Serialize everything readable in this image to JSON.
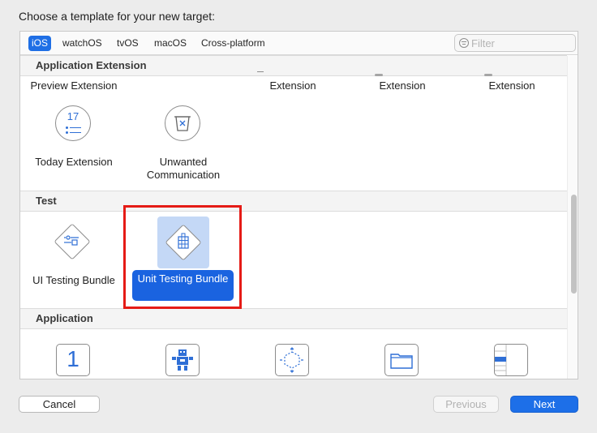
{
  "header": {
    "title": "Choose a template for your new target:"
  },
  "toolbar": {
    "platforms": [
      "iOS",
      "watchOS",
      "tvOS",
      "macOS",
      "Cross-platform"
    ],
    "selected_platform": "iOS",
    "filter_placeholder": "Filter"
  },
  "sections": {
    "app_extension": {
      "title": "Application Extension",
      "partial_row": [
        "Preview Extension",
        "Extension",
        "Extension",
        "Extension"
      ],
      "items": [
        {
          "label": "Today Extension",
          "icon": "calendar-17-icon",
          "icon_text": "17"
        },
        {
          "label": "Unwanted Communication",
          "icon": "spam-filter-icon"
        }
      ]
    },
    "test": {
      "title": "Test",
      "items": [
        {
          "label": "UI Testing Bundle",
          "icon": "ui-testing-icon"
        },
        {
          "label": "Unit Testing Bundle",
          "icon": "unit-testing-icon",
          "selected": true
        }
      ]
    },
    "application": {
      "title": "Application",
      "items": [
        {
          "icon": "single-view-app-icon",
          "icon_text": "1"
        },
        {
          "icon": "game-icon"
        },
        {
          "icon": "augmented-reality-icon"
        },
        {
          "icon": "document-app-icon"
        },
        {
          "icon": "master-detail-app-icon"
        }
      ]
    }
  },
  "buttons": {
    "cancel": "Cancel",
    "previous": "Previous",
    "next": "Next"
  },
  "colors": {
    "accent": "#1d6fe8",
    "selection_tile": "#c4d8f6",
    "annotation": "#e51b16"
  }
}
